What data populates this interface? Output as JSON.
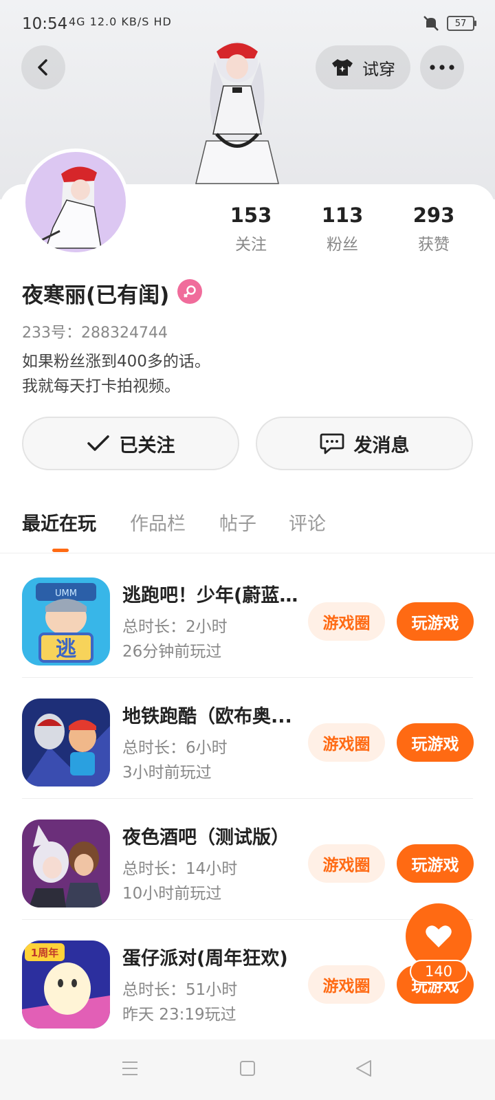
{
  "status_bar": {
    "time": "10:54",
    "network_info": "4G  12.0 KB/S  HD",
    "battery": "57"
  },
  "header": {
    "try_on_label": "试穿"
  },
  "profile": {
    "stats": [
      {
        "value": "153",
        "label": "关注"
      },
      {
        "value": "113",
        "label": "粉丝"
      },
      {
        "value": "293",
        "label": "获赞"
      }
    ],
    "username": "夜寒丽(已有闺)",
    "uid": "233号：288324744",
    "bio_line1": "如果粉丝涨到400多的话。",
    "bio_line2": "我就每天打卡拍视频。",
    "follow_label": "已关注",
    "message_label": "发消息"
  },
  "tabs": [
    "最近在玩",
    "作品栏",
    "帖子",
    "评论"
  ],
  "games": [
    {
      "name": "逃跑吧！少年(蔚蓝...",
      "duration": "总时长：2小时",
      "last_played": "26分钟前玩过",
      "circle_label": "游戏圈",
      "play_label": "玩游戏"
    },
    {
      "name": "地铁跑酷（欧布奥...",
      "duration": "总时长：6小时",
      "last_played": "3小时前玩过",
      "circle_label": "游戏圈",
      "play_label": "玩游戏"
    },
    {
      "name": "夜色酒吧（测试版）",
      "duration": "总时长：14小时",
      "last_played": "10小时前玩过",
      "circle_label": "游戏圈",
      "play_label": "玩游戏"
    },
    {
      "name": "蛋仔派对(周年狂欢)",
      "duration": "总时长：51小时",
      "last_played": "昨天 23:19玩过",
      "circle_label": "游戏圈",
      "play_label": "玩游戏"
    }
  ],
  "game_icon_texts": {
    "g1_top": "UMM",
    "g1_badge": "逃",
    "g4_badge": "1周年"
  },
  "like": {
    "count": "140"
  },
  "colors": {
    "accent": "#ff6a13",
    "accent_light": "#fff0e6",
    "gender": "#f06c9b"
  }
}
